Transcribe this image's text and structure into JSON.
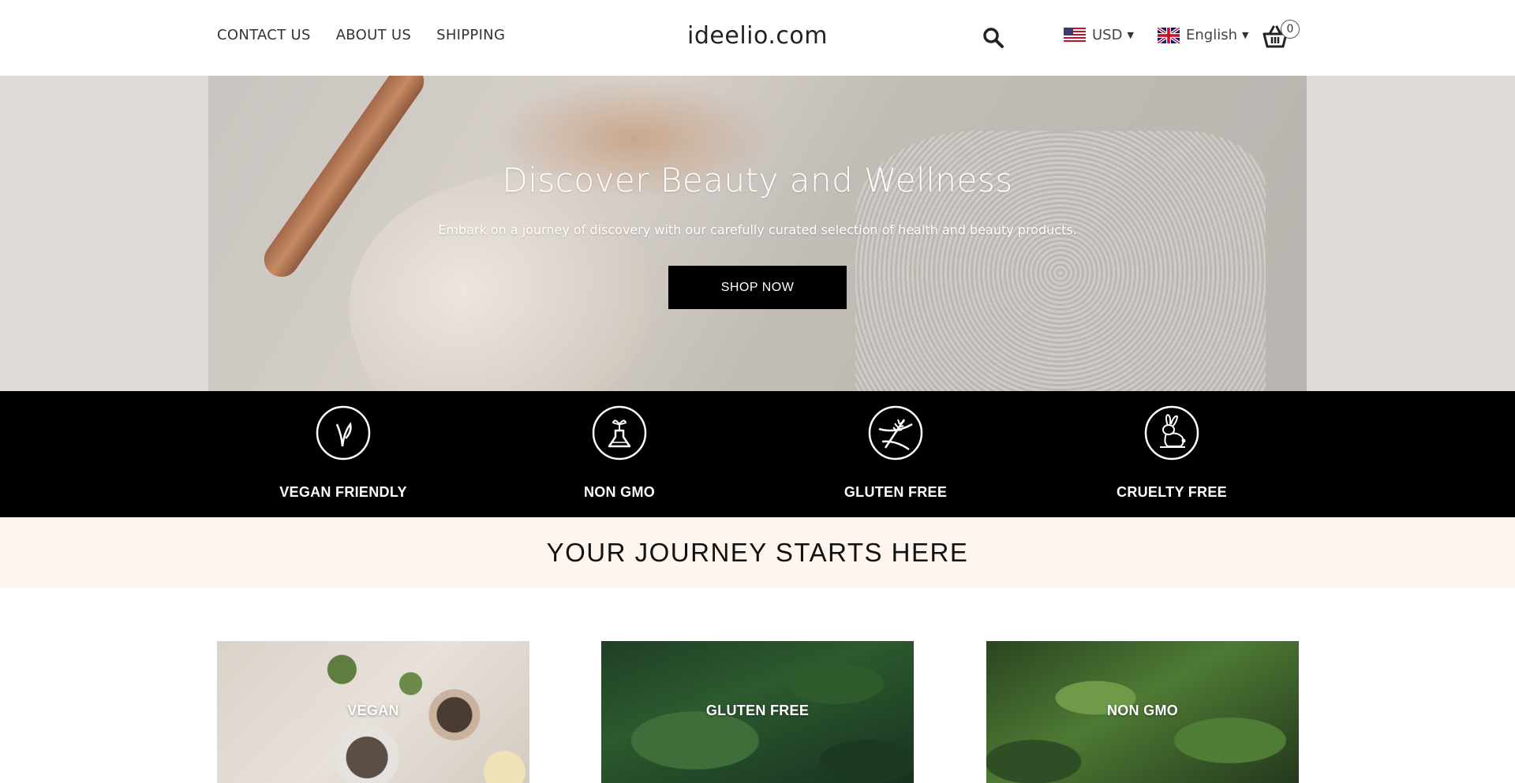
{
  "header": {
    "nav": [
      "CONTACT US",
      "ABOUT US",
      "SHIPPING"
    ],
    "logo": "ideelio.com",
    "currency": "USD",
    "language": "English",
    "cart_count": "0"
  },
  "hero": {
    "title": "Discover Beauty and Wellness",
    "subtitle": "Embark on a journey of discovery with our carefully curated selection of health and beauty products.",
    "cta": "SHOP NOW"
  },
  "features": [
    {
      "label": "VEGAN FRIENDLY",
      "icon": "leaf-icon"
    },
    {
      "label": "NON GMO",
      "icon": "flask-sprout-icon"
    },
    {
      "label": "GLUTEN FREE",
      "icon": "wheat-crossed-icon"
    },
    {
      "label": "CRUELTY FREE",
      "icon": "rabbit-icon"
    }
  ],
  "section_title": "YOUR JOURNEY STARTS HERE",
  "categories": [
    "VEGAN",
    "GLUTEN FREE",
    "NON GMO"
  ],
  "colors": {
    "feature_bar": "#000000",
    "journey_bg": "#fdf5ee",
    "cta_bg": "#000000"
  }
}
